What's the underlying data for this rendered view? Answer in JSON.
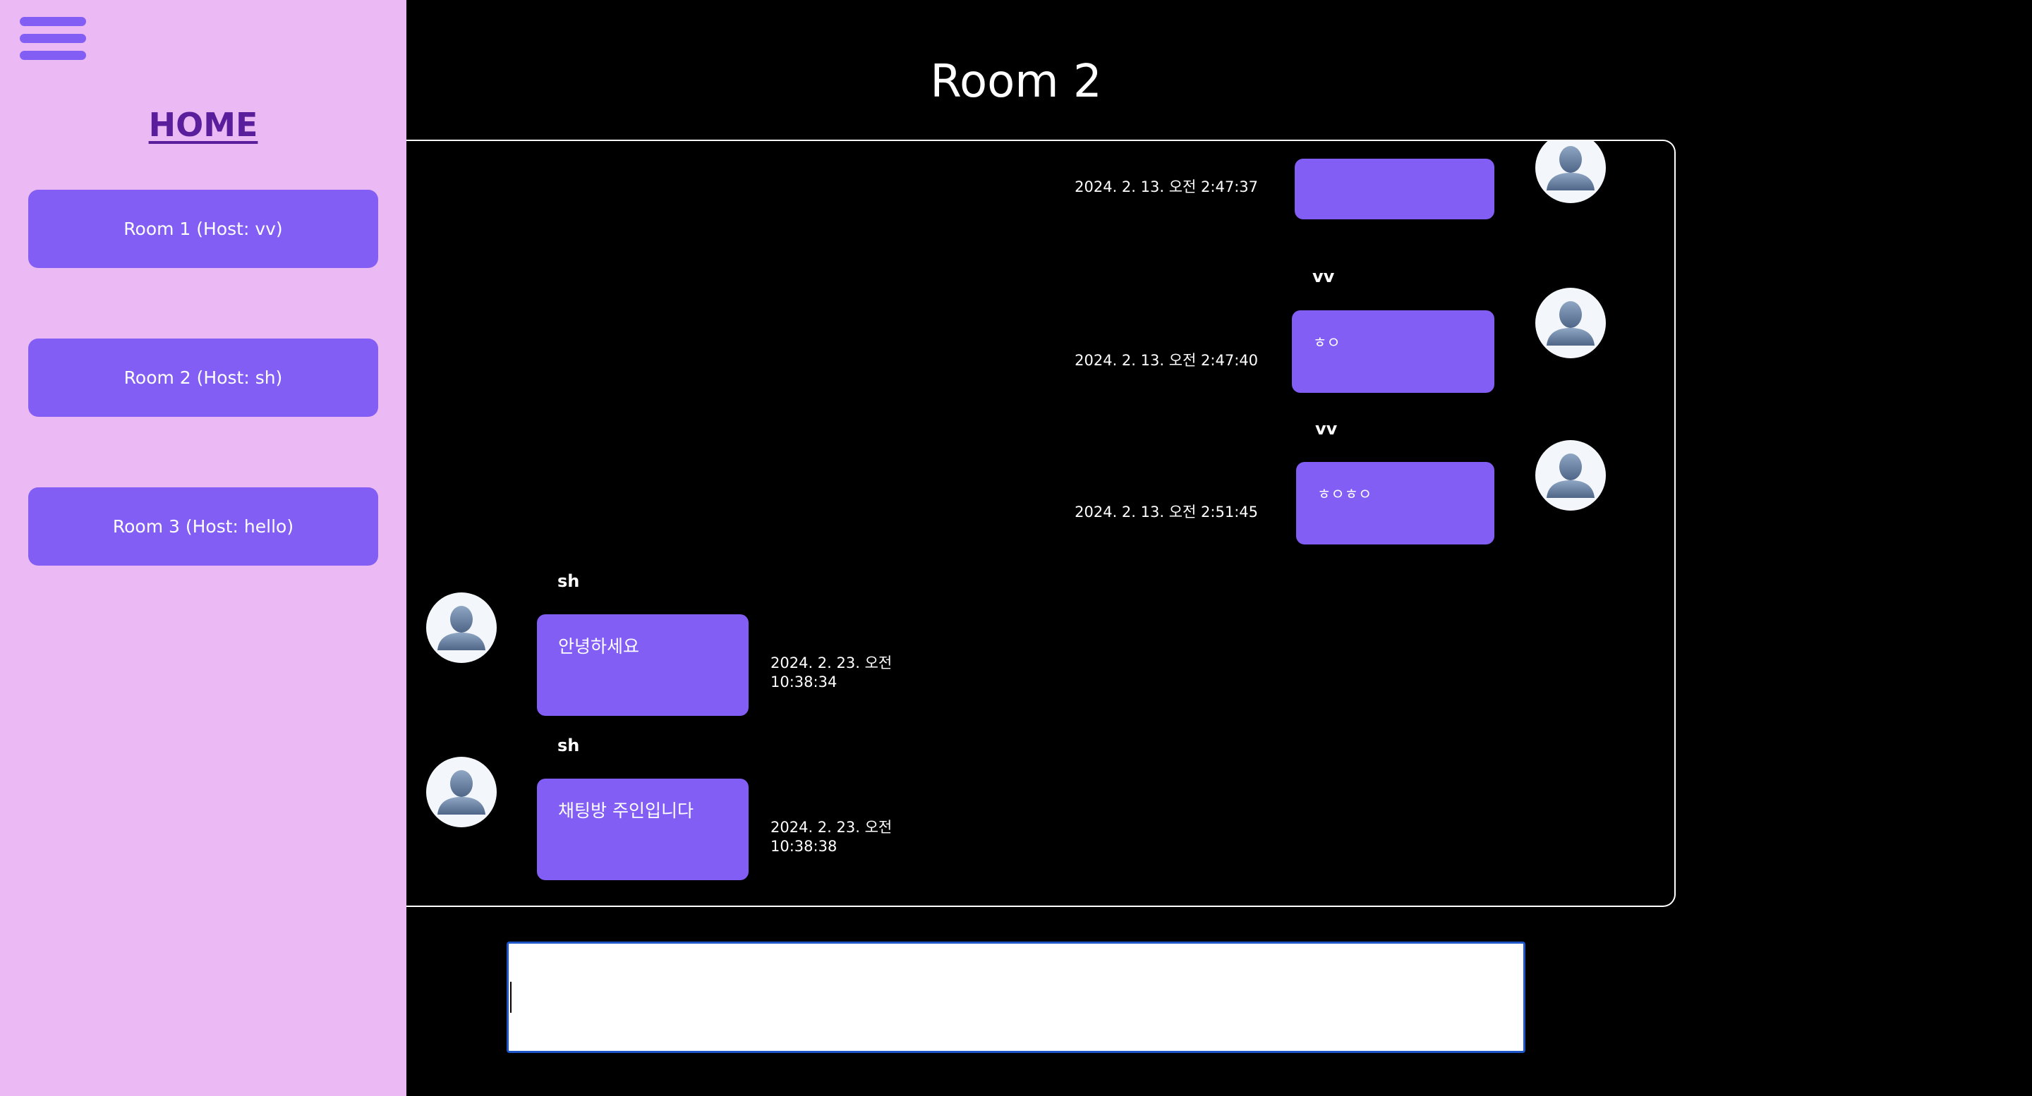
{
  "sidebar": {
    "menu_icon": "hamburger-menu-icon",
    "home_label": "HOME",
    "rooms": [
      {
        "label": "Room 1 (Host: vv)"
      },
      {
        "label": "Room 2 (Host: sh)"
      },
      {
        "label": "Room 3 (Host: hello)"
      }
    ]
  },
  "room": {
    "title": "Room 2"
  },
  "messages": [
    {
      "side": "right",
      "user": "",
      "text": "",
      "time": "2024. 2. 13. 오전 2:47:37"
    },
    {
      "side": "right",
      "user": "vv",
      "text": "ㅎㅇ",
      "time": "2024. 2. 13. 오전 2:47:40"
    },
    {
      "side": "right",
      "user": "vv",
      "text": "ㅎㅇㅎㅇ",
      "time": "2024. 2. 13. 오전 2:51:45"
    },
    {
      "side": "left",
      "user": "sh",
      "text": "안녕하세요",
      "time_line1": "2024. 2. 23. 오전",
      "time_line2": "10:38:34"
    },
    {
      "side": "left",
      "user": "sh",
      "text": "채팅방 주인입니다",
      "time_line1": "2024. 2. 23. 오전",
      "time_line2": "10:38:38"
    }
  ],
  "composer": {
    "value": "",
    "placeholder": ""
  },
  "colors": {
    "sidebar_bg": "#ebb9f4",
    "accent": "#825ef5",
    "home_link": "#5a1d9c",
    "background": "#000000",
    "input_border": "#1e56c8"
  },
  "icons": {
    "avatar": "user-avatar-icon"
  }
}
